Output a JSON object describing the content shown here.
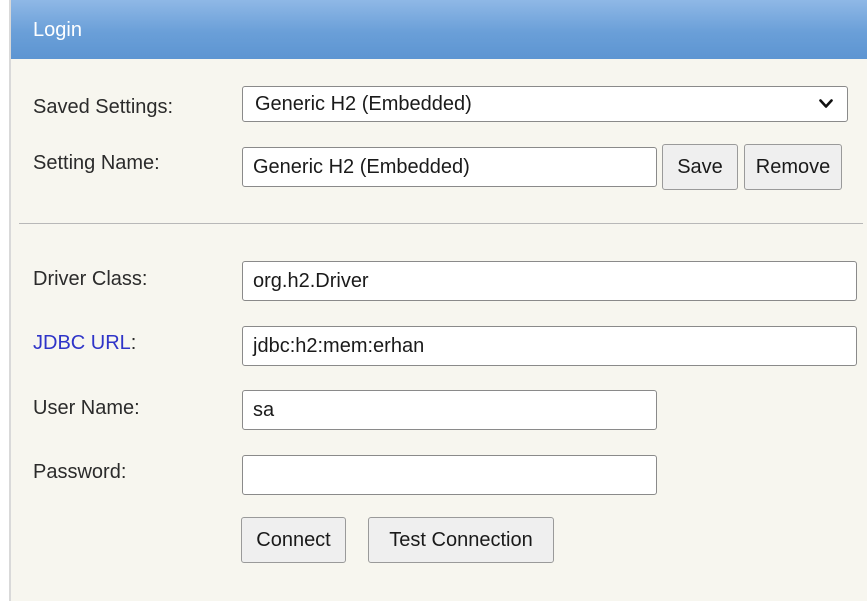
{
  "window": {
    "title": "Login"
  },
  "saved_settings": {
    "label": "Saved Settings:",
    "selected": "Generic H2 (Embedded)"
  },
  "setting_name": {
    "label": "Setting Name:",
    "value": "Generic H2 (Embedded)",
    "save_label": "Save",
    "remove_label": "Remove"
  },
  "driver_class": {
    "label": "Driver Class:",
    "value": "org.h2.Driver"
  },
  "jdbc_url": {
    "label": "JDBC URL",
    "colon": ":",
    "value": "jdbc:h2:mem:erhan"
  },
  "user_name": {
    "label": "User Name:",
    "value": "sa"
  },
  "password": {
    "label": "Password:",
    "value": ""
  },
  "actions": {
    "connect_label": "Connect",
    "test_label": "Test Connection"
  },
  "icons": {
    "dropdown": "chevron-down-icon"
  },
  "colors": {
    "titlebar": "#6a9fd8",
    "panel_bg": "#f7f6ef",
    "link_label": "#2f34c8"
  }
}
